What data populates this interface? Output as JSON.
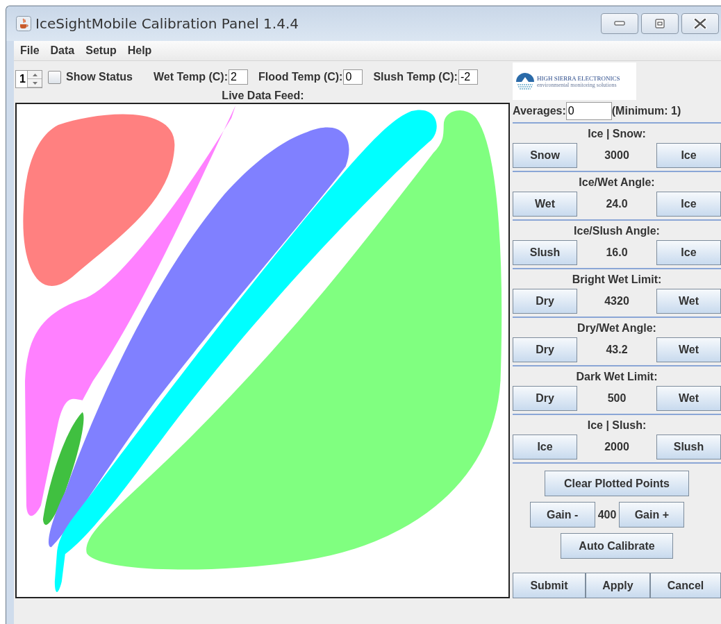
{
  "window": {
    "title": "IceSightMobile Calibration Panel 1.4.4"
  },
  "menu": [
    "File",
    "Data",
    "Setup",
    "Help"
  ],
  "toolbar": {
    "spinner": {
      "value": "1"
    },
    "show_status": {
      "label": "Show Status",
      "checked": false
    },
    "fields": [
      {
        "label": "Wet Temp (C):",
        "value": "2"
      },
      {
        "label": "Flood Temp (C):",
        "value": "0"
      },
      {
        "label": "Slush Temp (C):",
        "value": "-2"
      }
    ]
  },
  "feed_label": "Live Data Feed:",
  "logo": {
    "name": "HIGH SIERRA ELECTRONICS",
    "tagline": "environmental monitoring solutions"
  },
  "averages": {
    "label": "Averages:",
    "value": "0",
    "note": "(Minimum: 1)"
  },
  "sections": [
    {
      "title": "Ice | Snow:",
      "left": "Snow",
      "value": "3000",
      "right": "Ice"
    },
    {
      "title": "Ice/Wet Angle:",
      "left": "Wet",
      "value": "24.0",
      "right": "Ice"
    },
    {
      "title": "Ice/Slush Angle:",
      "left": "Slush",
      "value": "16.0",
      "right": "Ice"
    },
    {
      "title": "Bright Wet Limit:",
      "left": "Dry",
      "value": "4320",
      "right": "Wet"
    },
    {
      "title": "Dry/Wet Angle:",
      "left": "Dry",
      "value": "43.2",
      "right": "Wet"
    },
    {
      "title": "Dark Wet Limit:",
      "left": "Dry",
      "value": "500",
      "right": "Wet"
    },
    {
      "title": "Ice | Slush:",
      "left": "Ice",
      "value": "2000",
      "right": "Slush"
    }
  ],
  "clear_button": "Clear Plotted Points",
  "gain": {
    "minus": "Gain -",
    "value": "400",
    "plus": "Gain +"
  },
  "auto_calibrate": "Auto Calibrate",
  "footer_buttons": [
    "Submit",
    "Apply",
    "Cancel"
  ]
}
